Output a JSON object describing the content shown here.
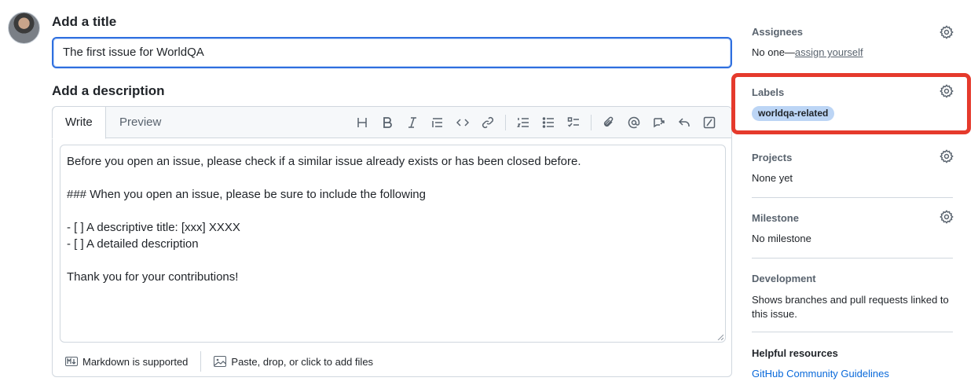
{
  "title_section": {
    "heading": "Add a title",
    "value": "The first issue for WorldQA"
  },
  "description_section": {
    "heading": "Add a description",
    "tabs": [
      "Write",
      "Preview"
    ],
    "body_lines": [
      "Before you open an issue, please check if a similar issue already exists or has been closed before.",
      "",
      "### When you open an issue, please be sure to include the following",
      "",
      "- [ ] A descriptive title: [xxx] XXXX",
      "- [ ] A detailed description",
      "",
      "Thank you for your contributions!"
    ],
    "footer": {
      "markdown": "Markdown is supported",
      "attach": "Paste, drop, or click to add files"
    }
  },
  "toolbar_icons": [
    "heading-icon",
    "bold-icon",
    "italic-icon",
    "quote-icon",
    "code-icon",
    "link-icon",
    "ordered-list-icon",
    "unordered-list-icon",
    "task-list-icon",
    "attach-icon",
    "mention-icon",
    "reference-icon",
    "reply-icon",
    "slash-command-icon"
  ],
  "sidebar": {
    "assignees": {
      "title": "Assignees",
      "value_prefix": "No one—",
      "value_link": "assign yourself"
    },
    "labels": {
      "title": "Labels",
      "label": "worldqa-related"
    },
    "projects": {
      "title": "Projects",
      "value": "None yet"
    },
    "milestone": {
      "title": "Milestone",
      "value": "No milestone"
    },
    "development": {
      "title": "Development",
      "value": "Shows branches and pull requests linked to this issue."
    },
    "helpful": {
      "title": "Helpful resources",
      "link": "GitHub Community Guidelines"
    }
  },
  "colors": {
    "accent_blue": "#0969da",
    "focus_border": "#2f6fdf",
    "highlight_red": "#e53a2c",
    "label_bg": "#bcd5f5"
  }
}
